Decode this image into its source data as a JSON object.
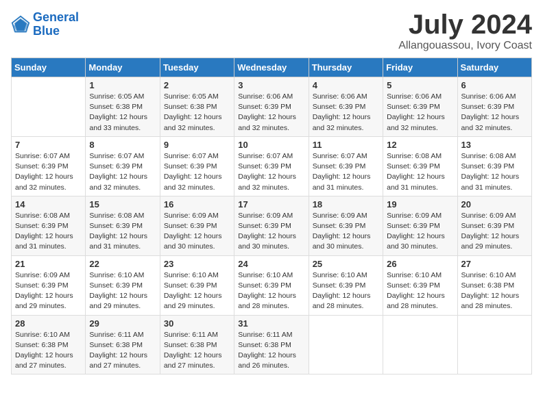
{
  "logo": {
    "name_line1": "General",
    "name_line2": "Blue"
  },
  "title": "July 2024",
  "location": "Allangouassou, Ivory Coast",
  "header": {
    "days": [
      "Sunday",
      "Monday",
      "Tuesday",
      "Wednesday",
      "Thursday",
      "Friday",
      "Saturday"
    ]
  },
  "weeks": [
    {
      "cells": [
        {
          "date": "",
          "info": ""
        },
        {
          "date": "1",
          "info": "Sunrise: 6:05 AM\nSunset: 6:38 PM\nDaylight: 12 hours\nand 33 minutes."
        },
        {
          "date": "2",
          "info": "Sunrise: 6:05 AM\nSunset: 6:38 PM\nDaylight: 12 hours\nand 32 minutes."
        },
        {
          "date": "3",
          "info": "Sunrise: 6:06 AM\nSunset: 6:39 PM\nDaylight: 12 hours\nand 32 minutes."
        },
        {
          "date": "4",
          "info": "Sunrise: 6:06 AM\nSunset: 6:39 PM\nDaylight: 12 hours\nand 32 minutes."
        },
        {
          "date": "5",
          "info": "Sunrise: 6:06 AM\nSunset: 6:39 PM\nDaylight: 12 hours\nand 32 minutes."
        },
        {
          "date": "6",
          "info": "Sunrise: 6:06 AM\nSunset: 6:39 PM\nDaylight: 12 hours\nand 32 minutes."
        }
      ]
    },
    {
      "cells": [
        {
          "date": "7",
          "info": "Sunrise: 6:07 AM\nSunset: 6:39 PM\nDaylight: 12 hours\nand 32 minutes."
        },
        {
          "date": "8",
          "info": "Sunrise: 6:07 AM\nSunset: 6:39 PM\nDaylight: 12 hours\nand 32 minutes."
        },
        {
          "date": "9",
          "info": "Sunrise: 6:07 AM\nSunset: 6:39 PM\nDaylight: 12 hours\nand 32 minutes."
        },
        {
          "date": "10",
          "info": "Sunrise: 6:07 AM\nSunset: 6:39 PM\nDaylight: 12 hours\nand 32 minutes."
        },
        {
          "date": "11",
          "info": "Sunrise: 6:07 AM\nSunset: 6:39 PM\nDaylight: 12 hours\nand 31 minutes."
        },
        {
          "date": "12",
          "info": "Sunrise: 6:08 AM\nSunset: 6:39 PM\nDaylight: 12 hours\nand 31 minutes."
        },
        {
          "date": "13",
          "info": "Sunrise: 6:08 AM\nSunset: 6:39 PM\nDaylight: 12 hours\nand 31 minutes."
        }
      ]
    },
    {
      "cells": [
        {
          "date": "14",
          "info": "Sunrise: 6:08 AM\nSunset: 6:39 PM\nDaylight: 12 hours\nand 31 minutes."
        },
        {
          "date": "15",
          "info": "Sunrise: 6:08 AM\nSunset: 6:39 PM\nDaylight: 12 hours\nand 31 minutes."
        },
        {
          "date": "16",
          "info": "Sunrise: 6:09 AM\nSunset: 6:39 PM\nDaylight: 12 hours\nand 30 minutes."
        },
        {
          "date": "17",
          "info": "Sunrise: 6:09 AM\nSunset: 6:39 PM\nDaylight: 12 hours\nand 30 minutes."
        },
        {
          "date": "18",
          "info": "Sunrise: 6:09 AM\nSunset: 6:39 PM\nDaylight: 12 hours\nand 30 minutes."
        },
        {
          "date": "19",
          "info": "Sunrise: 6:09 AM\nSunset: 6:39 PM\nDaylight: 12 hours\nand 30 minutes."
        },
        {
          "date": "20",
          "info": "Sunrise: 6:09 AM\nSunset: 6:39 PM\nDaylight: 12 hours\nand 29 minutes."
        }
      ]
    },
    {
      "cells": [
        {
          "date": "21",
          "info": "Sunrise: 6:09 AM\nSunset: 6:39 PM\nDaylight: 12 hours\nand 29 minutes."
        },
        {
          "date": "22",
          "info": "Sunrise: 6:10 AM\nSunset: 6:39 PM\nDaylight: 12 hours\nand 29 minutes."
        },
        {
          "date": "23",
          "info": "Sunrise: 6:10 AM\nSunset: 6:39 PM\nDaylight: 12 hours\nand 29 minutes."
        },
        {
          "date": "24",
          "info": "Sunrise: 6:10 AM\nSunset: 6:39 PM\nDaylight: 12 hours\nand 28 minutes."
        },
        {
          "date": "25",
          "info": "Sunrise: 6:10 AM\nSunset: 6:39 PM\nDaylight: 12 hours\nand 28 minutes."
        },
        {
          "date": "26",
          "info": "Sunrise: 6:10 AM\nSunset: 6:39 PM\nDaylight: 12 hours\nand 28 minutes."
        },
        {
          "date": "27",
          "info": "Sunrise: 6:10 AM\nSunset: 6:38 PM\nDaylight: 12 hours\nand 28 minutes."
        }
      ]
    },
    {
      "cells": [
        {
          "date": "28",
          "info": "Sunrise: 6:10 AM\nSunset: 6:38 PM\nDaylight: 12 hours\nand 27 minutes."
        },
        {
          "date": "29",
          "info": "Sunrise: 6:11 AM\nSunset: 6:38 PM\nDaylight: 12 hours\nand 27 minutes."
        },
        {
          "date": "30",
          "info": "Sunrise: 6:11 AM\nSunset: 6:38 PM\nDaylight: 12 hours\nand 27 minutes."
        },
        {
          "date": "31",
          "info": "Sunrise: 6:11 AM\nSunset: 6:38 PM\nDaylight: 12 hours\nand 26 minutes."
        },
        {
          "date": "",
          "info": ""
        },
        {
          "date": "",
          "info": ""
        },
        {
          "date": "",
          "info": ""
        }
      ]
    }
  ]
}
